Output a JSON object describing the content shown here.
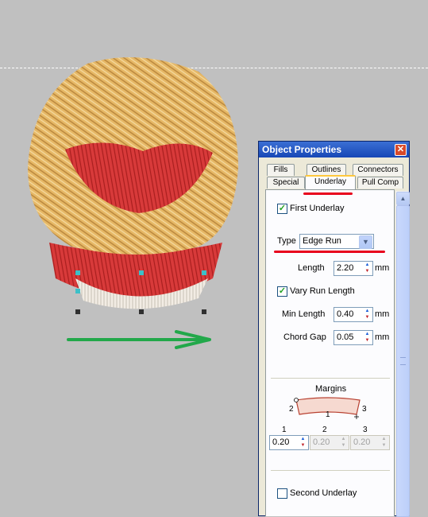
{
  "window": {
    "title": "Object Properties",
    "close_glyph": "✕"
  },
  "tabs_row1": [
    {
      "label": "Fills"
    },
    {
      "label": "Outlines"
    },
    {
      "label": "Connectors"
    }
  ],
  "tabs_row2": [
    {
      "label": "Special"
    },
    {
      "label": "Underlay",
      "active": true
    },
    {
      "label": "Pull Comp"
    }
  ],
  "underlay": {
    "first_underlay": {
      "label": "First Underlay",
      "checked": true
    },
    "type_label": "Type",
    "type_value": "Edge Run",
    "length": {
      "label": "Length",
      "value": "2.20",
      "unit": "mm"
    },
    "vary_run_length": {
      "label": "Vary Run Length",
      "checked": true
    },
    "min_length": {
      "label": "Min Length",
      "value": "0.40",
      "unit": "mm"
    },
    "chord_gap": {
      "label": "Chord Gap",
      "value": "0.05",
      "unit": "mm"
    },
    "margins": {
      "label": "Margins",
      "diagram_labels": [
        "2",
        "1",
        "3"
      ],
      "col_labels": [
        "1",
        "2",
        "3"
      ],
      "values": [
        "0.20",
        "0.20",
        "0.20"
      ],
      "enabled": [
        true,
        false,
        false
      ]
    },
    "second_underlay": {
      "label": "Second Underlay",
      "checked": false
    }
  },
  "colors": {
    "annotation_red": "#e8001c",
    "annotation_green": "#22a84a",
    "canvas_bg": "#c0c0c0"
  },
  "icons": {
    "check": "✓",
    "dropdown": "chevron-down-icon",
    "spin_up": "▲",
    "spin_down": "▼"
  }
}
